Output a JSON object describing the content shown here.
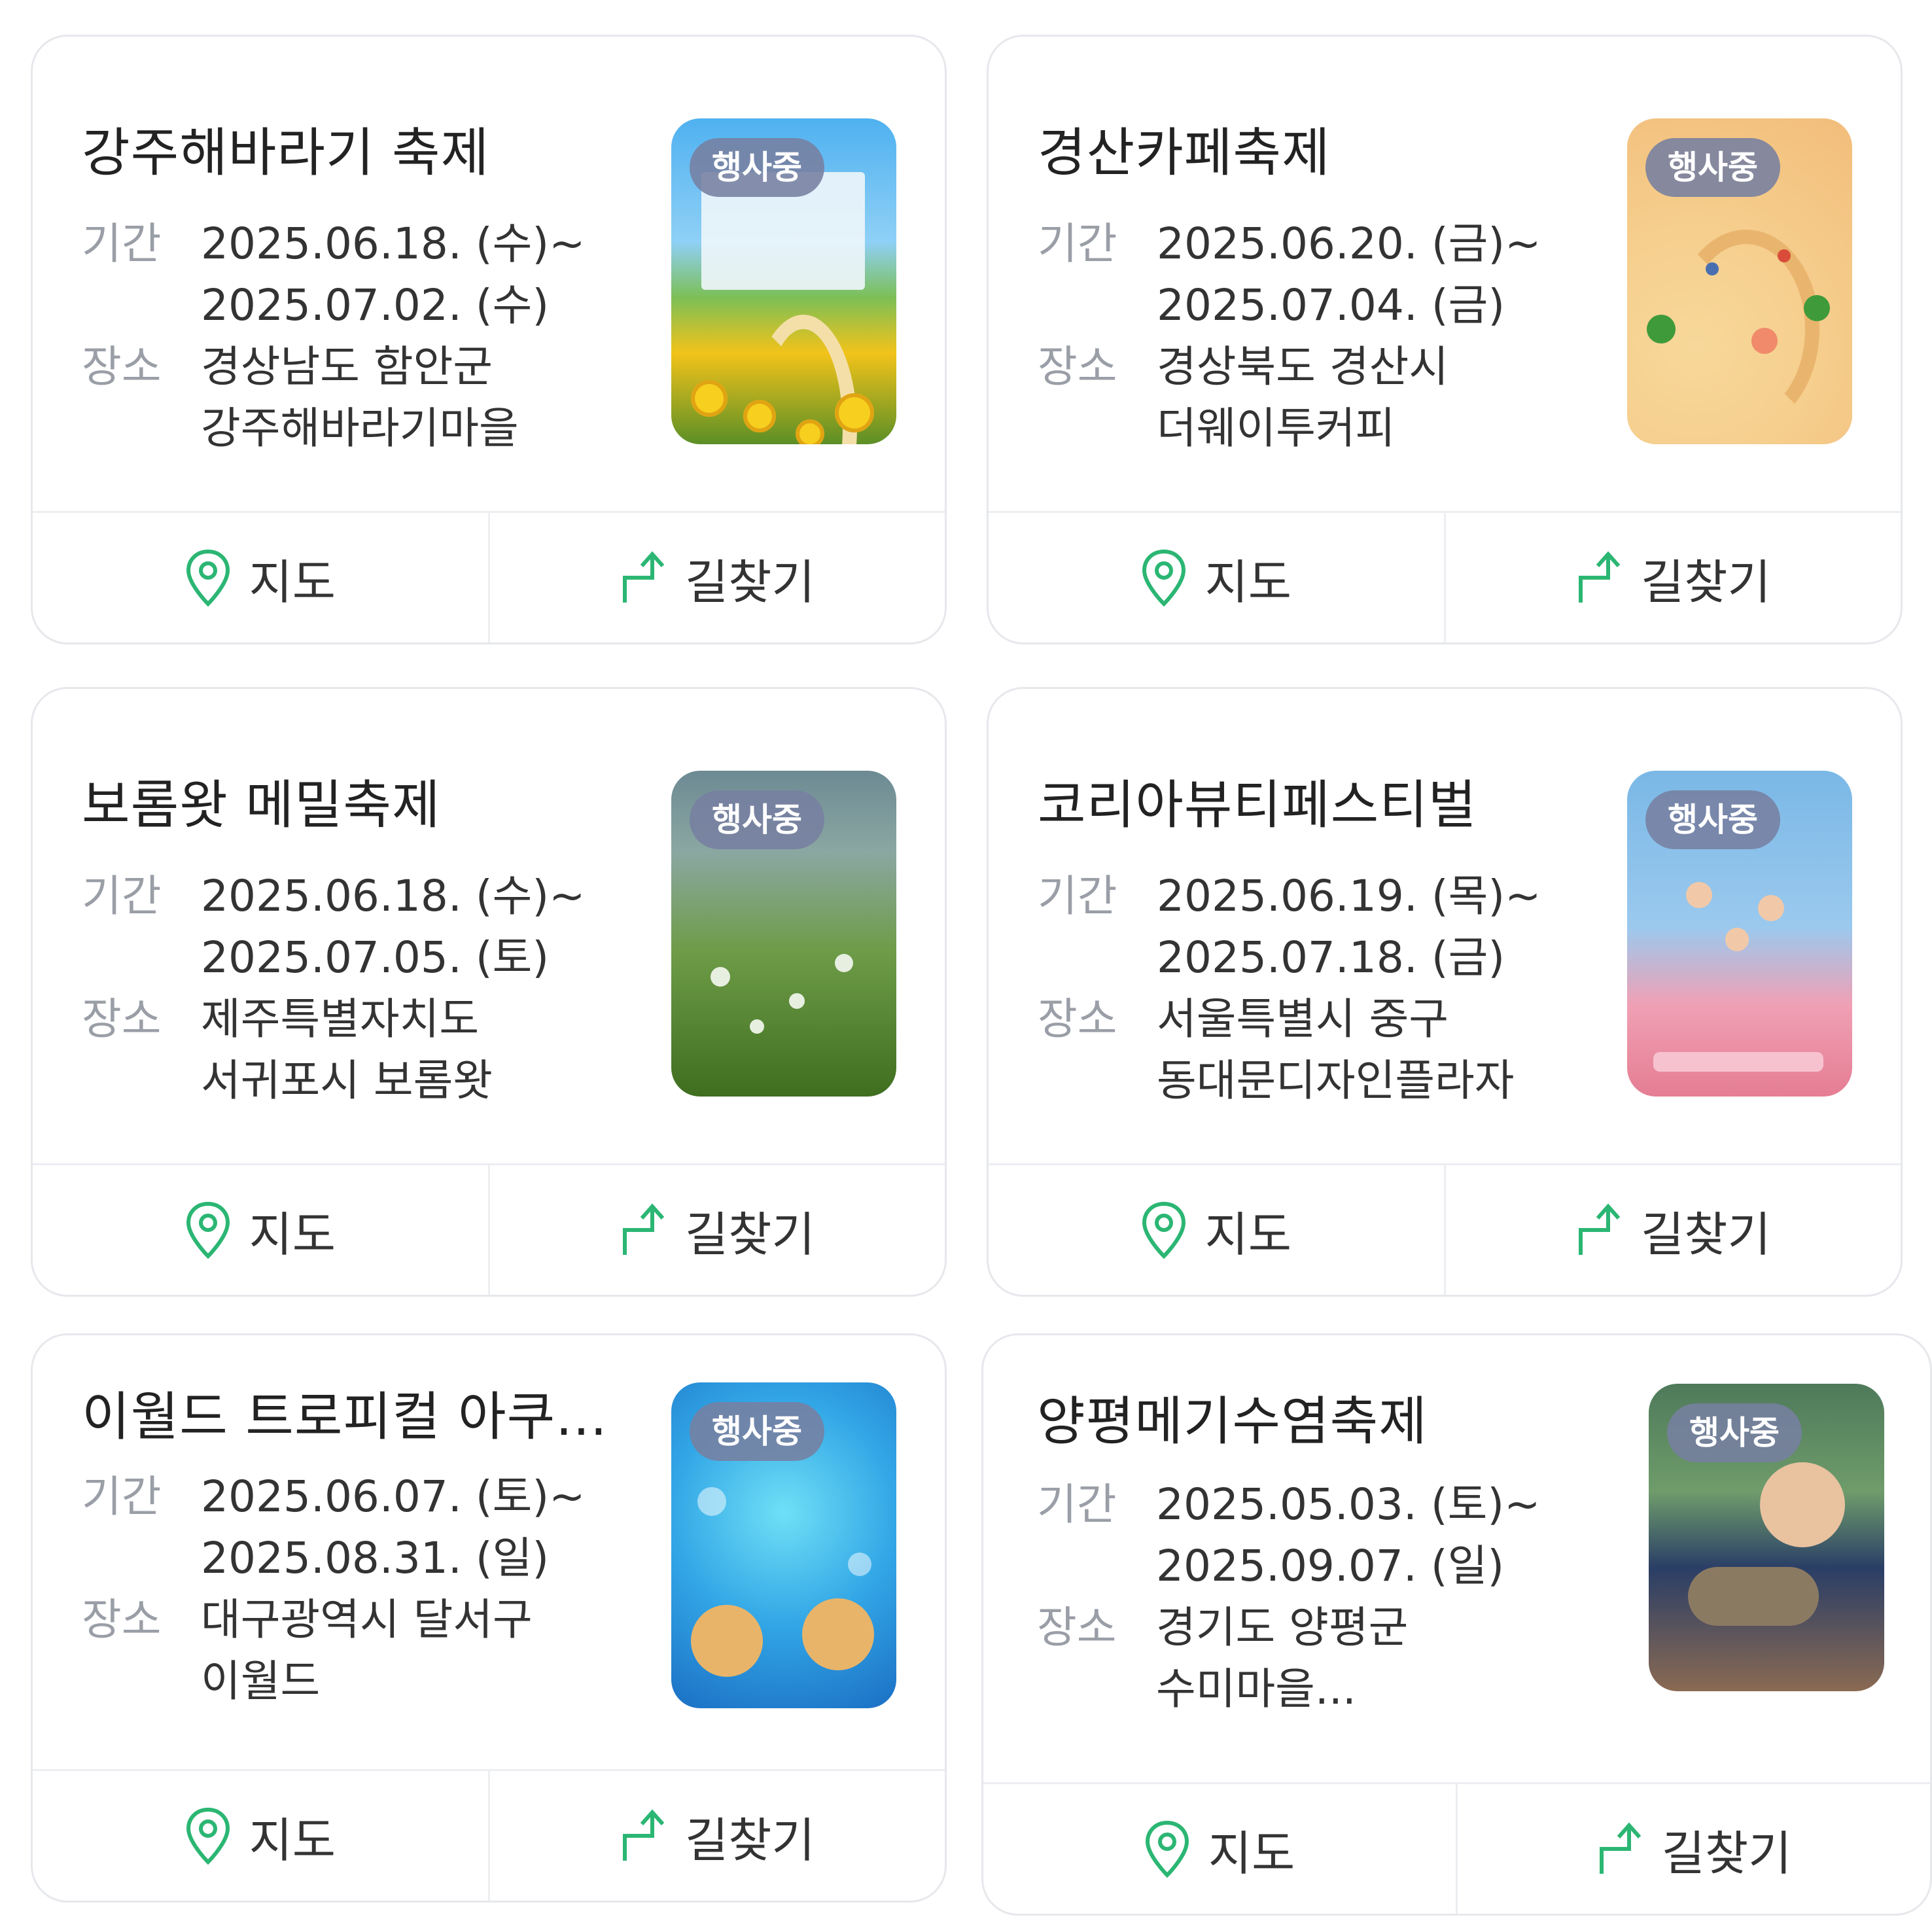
{
  "labels": {
    "period": "기간",
    "place": "장소",
    "map": "지도",
    "directions": "길찾기",
    "status": "행사중"
  },
  "cards": [
    {
      "title": "강주해바라기 축제",
      "period_start": "2025.06.18. (수)~",
      "period_end": "2025.07.02. (수)",
      "place_line1": "경상남도 함안군",
      "place_line2": "강주해바라기마을",
      "thumb_icon": "sunflower-festival-poster"
    },
    {
      "title": "경산카페축제",
      "period_start": "2025.06.20. (금)~",
      "period_end": "2025.07.04. (금)",
      "place_line1": "경상북도 경산시",
      "place_line2": "더웨이투커피",
      "thumb_icon": "cafe-festival-poster"
    },
    {
      "title": "보롬왓 메밀축제",
      "period_start": "2025.06.18. (수)~",
      "period_end": "2025.07.05. (토)",
      "place_line1": "제주특별자치도",
      "place_line2": "서귀포시 보롬왓",
      "thumb_icon": "buckwheat-festival-poster"
    },
    {
      "title": "코리아뷰티페스티벌",
      "period_start": "2025.06.19. (목)~",
      "period_end": "2025.07.18. (금)",
      "place_line1": "서울특별시 중구",
      "place_line2": "동대문디자인플라자",
      "thumb_icon": "korea-beauty-festival-poster"
    },
    {
      "title": "이월드 트로피컬 아쿠...",
      "period_start": "2025.06.07. (토)~",
      "period_end": "2025.08.31. (일)",
      "place_line1": "대구광역시 달서구",
      "place_line2": "이월드",
      "thumb_icon": "aqua-world-poster"
    },
    {
      "title": "양평메기수염축제",
      "period_start": "2025.05.03. (토)~",
      "period_end": "2025.09.07. (일)",
      "place_line1": "경기도 양평군",
      "place_line2": "수미마을...",
      "thumb_icon": "catfish-festival-photo"
    }
  ],
  "colors": {
    "accent_green": "#2bb673",
    "badge_bg": "#7680a0",
    "border": "#e6e8ec",
    "label_gray": "#9a9ea6"
  }
}
